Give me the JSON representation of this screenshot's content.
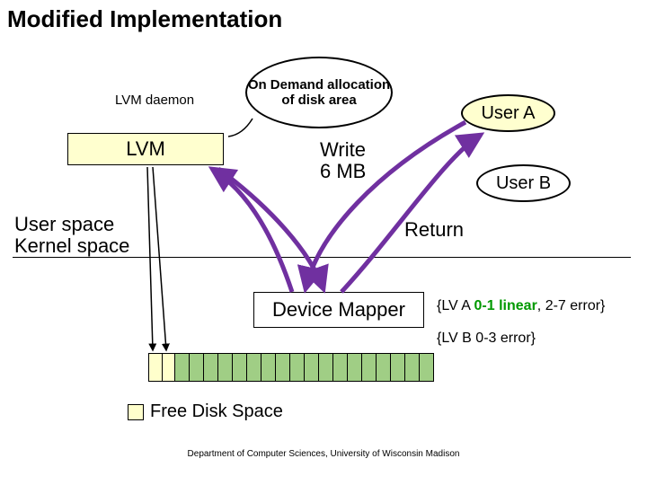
{
  "title": "Modified Implementation",
  "lvm_daemon": "LVM daemon",
  "on_demand": "On Demand allocation of disk area",
  "lvm": "LVM",
  "user_a": "User A",
  "user_b": "User B",
  "write": "Write\n6 MB",
  "user_space": "User space",
  "kernel_space": "Kernel space",
  "return": "Return",
  "device_mapper": "Device Mapper",
  "lv_a_prefix": "{LV A ",
  "lv_a_green": "0-1 linear",
  "lv_a_suffix": ", 2-7 error}",
  "lv_b": "{LV B 0-3 error}",
  "legend": "Free Disk Space",
  "footer": "Department of Computer Sciences, University of Wisconsin Madison",
  "disk_blocks": {
    "yellow_count": 2,
    "green_count": 18
  },
  "colors": {
    "highlight_fill": "#ffffcf",
    "green_block": "#a0ce85",
    "green_text": "#009900",
    "purple_arrow": "#7030a0"
  }
}
